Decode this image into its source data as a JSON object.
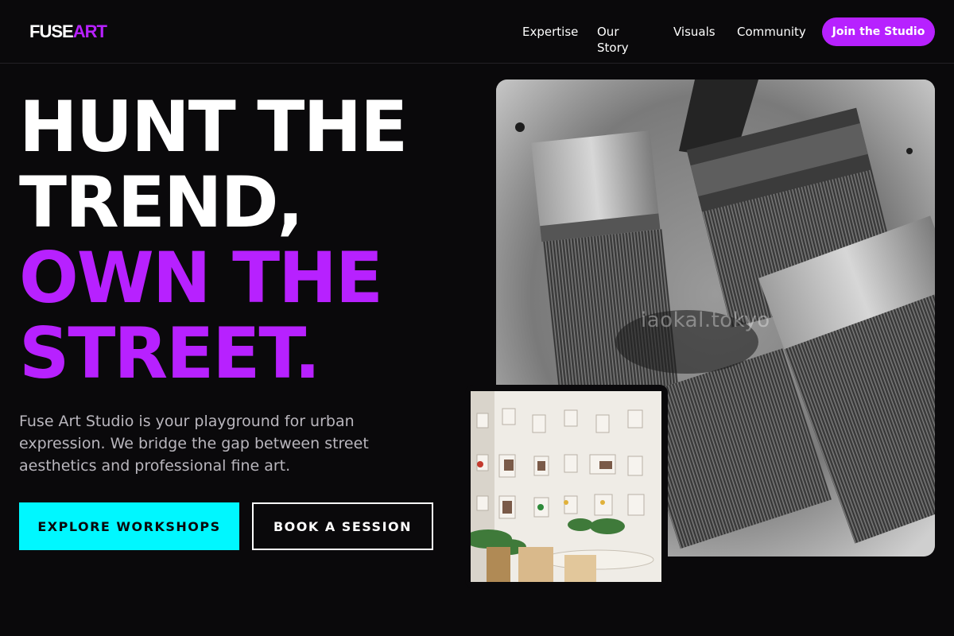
{
  "brand": {
    "logo_part1": "FUSE",
    "logo_part2": "ART",
    "accent": "#b721ff",
    "cta_color": "#00f7ff"
  },
  "nav": {
    "items": [
      "Expertise",
      "Our Story",
      "Visuals",
      "Community"
    ],
    "cta": "Join the Studio"
  },
  "hero": {
    "title_line1": "HUNT THE",
    "title_line2": "TREND,",
    "title_line3": "OWN THE",
    "title_line4": "STREET.",
    "description": "Fuse Art Studio is your playground for urban expression. We bridge the gap between street aesthetics and professional fine art.",
    "primary_button": "EXPLORE WORKSHOPS",
    "secondary_button": "BOOK A SESSION"
  },
  "images": {
    "main_watermark": "iaokal.tokyo",
    "main_subject": "paint-brushes-photo",
    "secondary_subject": "gallery-wall-photo"
  }
}
